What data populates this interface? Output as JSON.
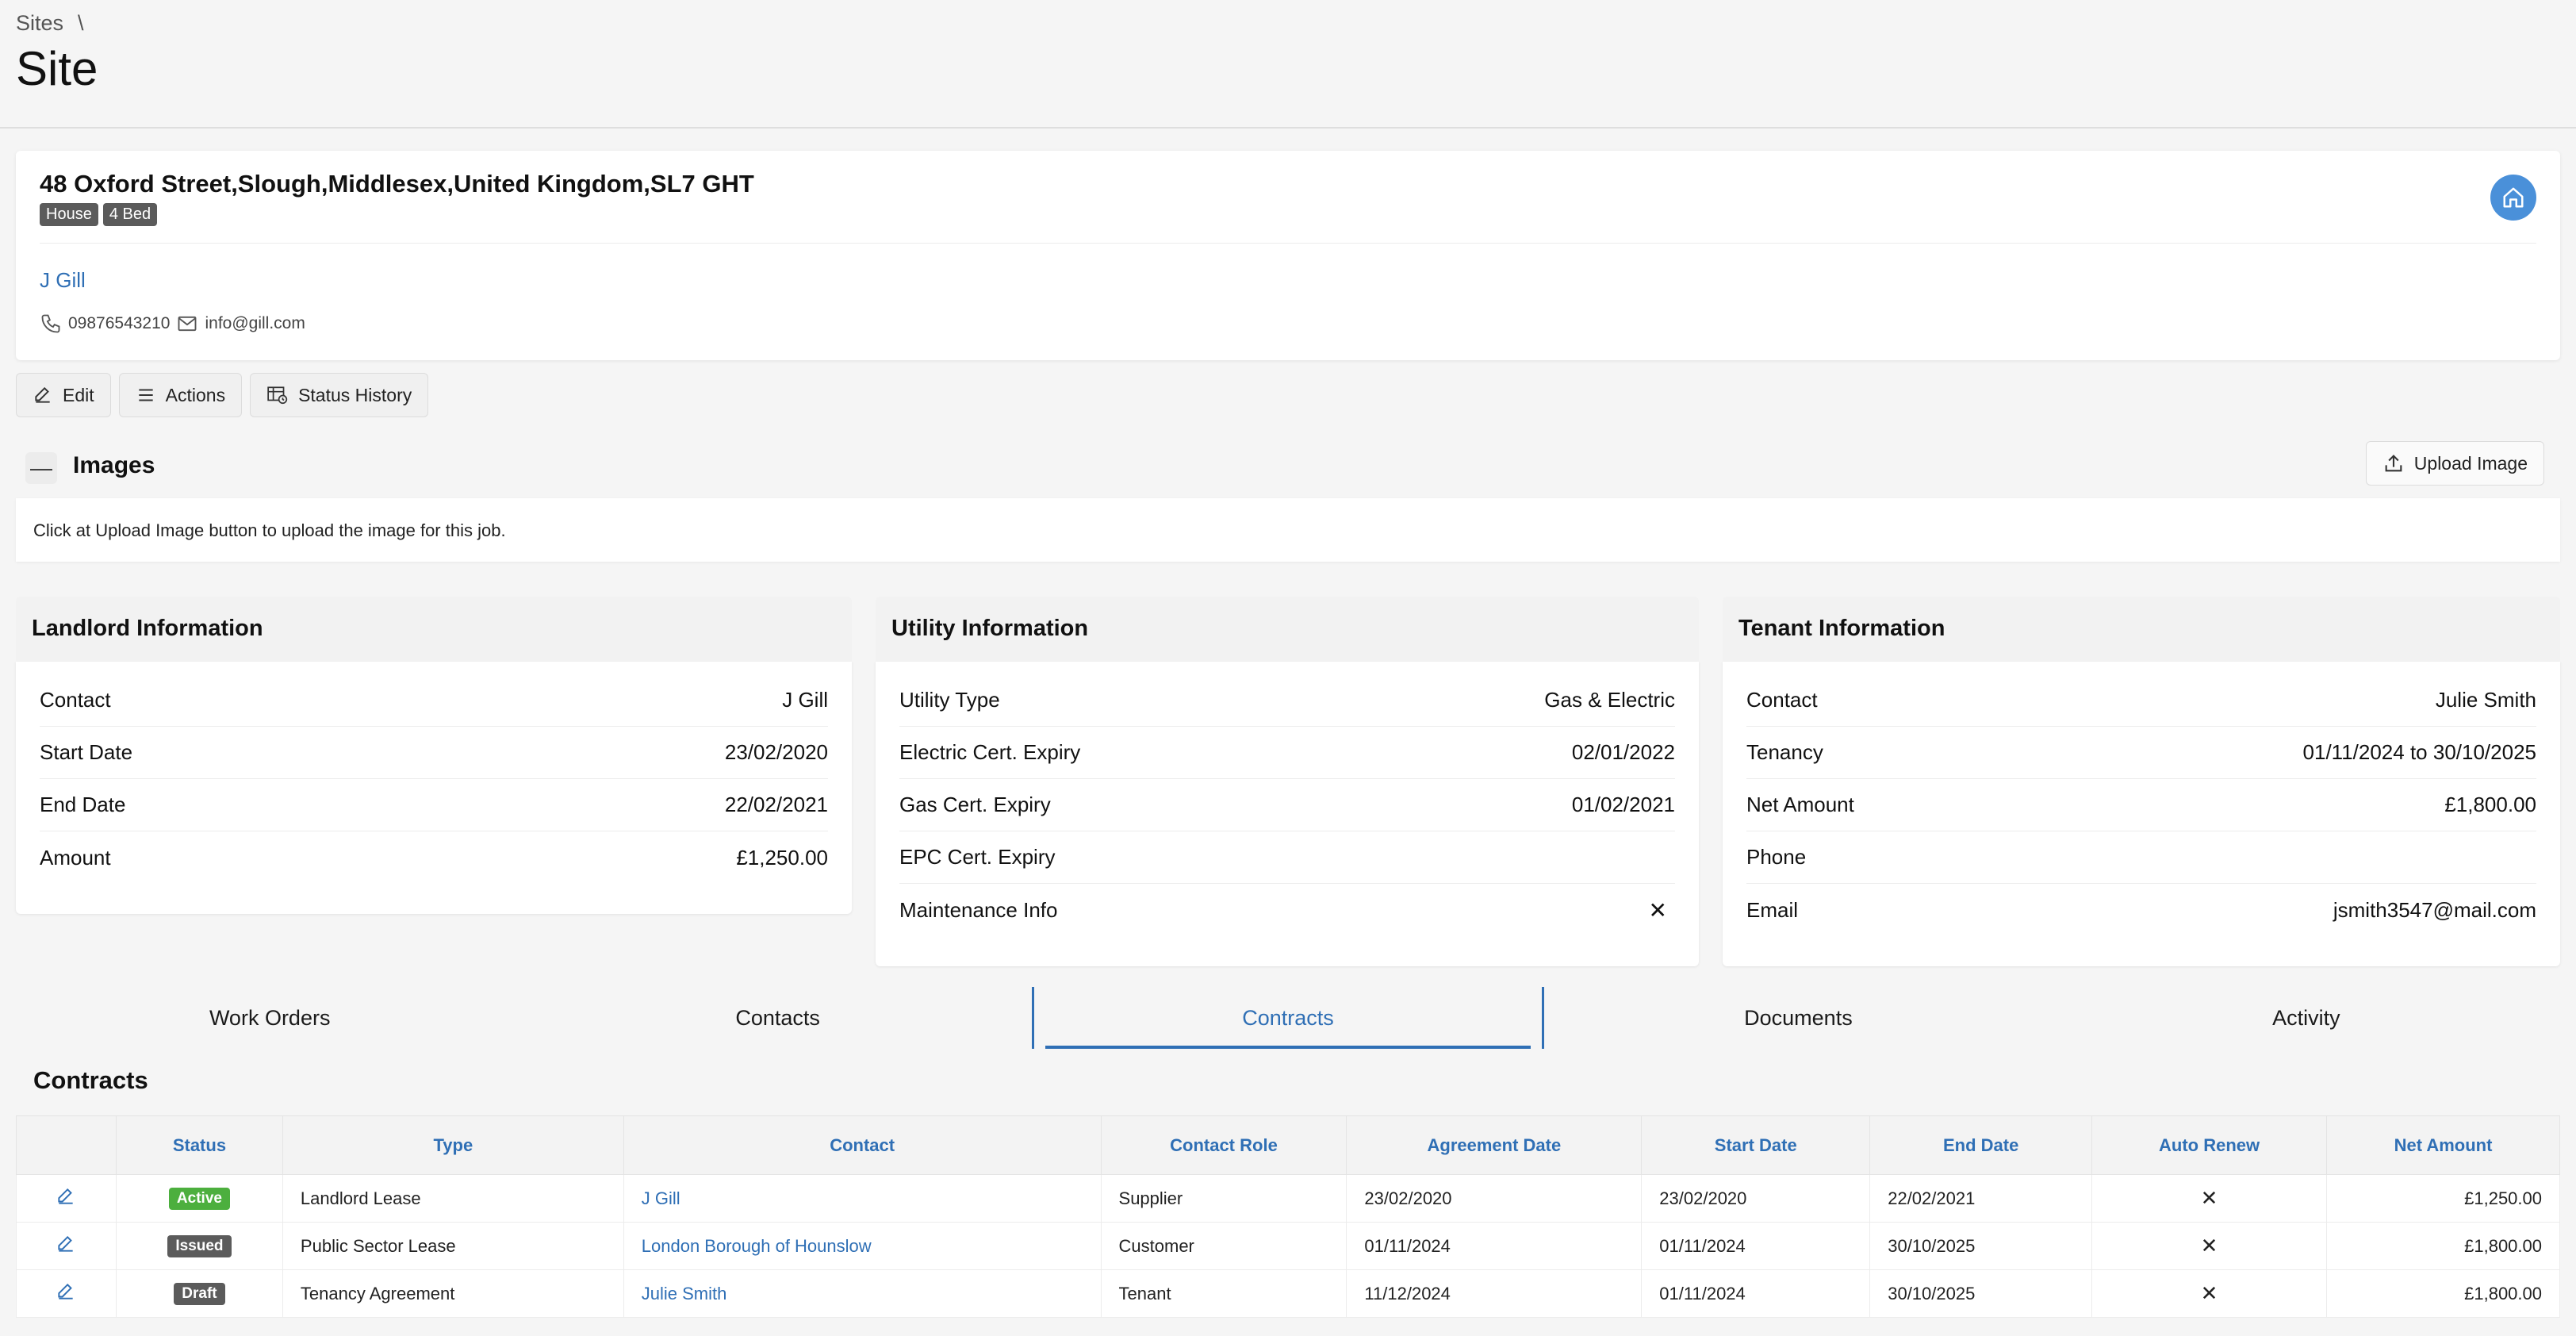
{
  "breadcrumb": {
    "root": "Sites",
    "sep": "\\"
  },
  "page": {
    "title": "Site"
  },
  "site": {
    "address": "48 Oxford Street,Slough,Middlesex,United Kingdom,SL7 GHT",
    "tags": [
      "House",
      "4 Bed"
    ],
    "owner": "J Gill",
    "phone": "09876543210",
    "email": "info@gill.com",
    "home_icon": "home-icon"
  },
  "toolbar": {
    "edit": "Edit",
    "actions": "Actions",
    "status_history": "Status History"
  },
  "images": {
    "collapse": "—",
    "title": "Images",
    "upload": "Upload Image",
    "message": "Click at Upload Image button to upload the image for this job."
  },
  "landlord": {
    "title": "Landlord Information",
    "rows": [
      {
        "k": "Contact",
        "v": "J Gill"
      },
      {
        "k": "Start Date",
        "v": "23/02/2020"
      },
      {
        "k": "End Date",
        "v": "22/02/2021"
      },
      {
        "k": "Amount",
        "v": "£1,250.00"
      }
    ]
  },
  "utility": {
    "title": "Utility Information",
    "rows": [
      {
        "k": "Utility Type",
        "v": "Gas & Electric"
      },
      {
        "k": "Electric Cert. Expiry",
        "v": "02/01/2022"
      },
      {
        "k": "Gas Cert. Expiry",
        "v": "01/02/2021"
      },
      {
        "k": "EPC Cert. Expiry",
        "v": ""
      },
      {
        "k": "Maintenance Info",
        "v": "✕"
      }
    ]
  },
  "tenant": {
    "title": "Tenant Information",
    "rows": [
      {
        "k": "Contact",
        "v": "Julie Smith"
      },
      {
        "k": "Tenancy",
        "v": "01/11/2024 to 30/10/2025"
      },
      {
        "k": "Net Amount",
        "v": "£1,800.00"
      },
      {
        "k": "Phone",
        "v": ""
      },
      {
        "k": "Email",
        "v": "jsmith3547@mail.com"
      }
    ]
  },
  "tabs": [
    "Work Orders",
    "Contacts",
    "Contracts",
    "Documents",
    "Activity"
  ],
  "active_tab": "Contracts",
  "contracts": {
    "title": "Contracts",
    "headers": [
      "",
      "Status",
      "Type",
      "Contact",
      "Contact Role",
      "Agreement Date",
      "Start Date",
      "End Date",
      "Auto Renew",
      "Net Amount"
    ],
    "rows": [
      {
        "status": "Active",
        "status_color": "#4caf3e",
        "type": "Landlord Lease",
        "contact": "J Gill",
        "role": "Supplier",
        "agreement": "23/02/2020",
        "start": "23/02/2020",
        "end": "22/02/2021",
        "renew": "✕",
        "amount": "£1,250.00"
      },
      {
        "status": "Issued",
        "status_color": "#5b5b5b",
        "type": "Public Sector Lease",
        "contact": "London Borough of Hounslow",
        "role": "Customer",
        "agreement": "01/11/2024",
        "start": "01/11/2024",
        "end": "30/10/2025",
        "renew": "✕",
        "amount": "£1,800.00"
      },
      {
        "status": "Draft",
        "status_color": "#5b5b5b",
        "type": "Tenancy Agreement",
        "contact": "Julie Smith",
        "role": "Tenant",
        "agreement": "11/12/2024",
        "start": "01/11/2024",
        "end": "30/10/2025",
        "renew": "✕",
        "amount": "£1,800.00"
      }
    ]
  },
  "colors": {
    "accent": "#2f6fb5",
    "home_button": "#4a90d9"
  }
}
